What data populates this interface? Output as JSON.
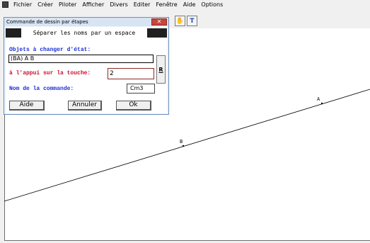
{
  "menubar": {
    "items": [
      "Fichier",
      "Créer",
      "Piloter",
      "Afficher",
      "Divers",
      "Editer",
      "Fenêtre",
      "Aide",
      "Options"
    ]
  },
  "toolbar": {
    "buttons": [
      {
        "icon": "hand-icon",
        "glyph": "✋"
      },
      {
        "icon": "text-tool-icon",
        "glyph": "T"
      }
    ]
  },
  "dialog": {
    "window_title": "Commande de dessin par étapes",
    "close_glyph": "✕",
    "instruction": "Séparer les noms par un espace",
    "objects_label": "Objets à changer d'état:",
    "objects_value": "(BA) A B",
    "key_label": "à l'appui sur la touche:",
    "key_value": "2",
    "command_label": "Nom de la commande:",
    "command_value": "Cm3",
    "r_button": "R",
    "buttons": {
      "help": "Aide",
      "cancel": "Annuler",
      "ok": "Ok"
    }
  },
  "drawing": {
    "points": [
      {
        "name": "A"
      },
      {
        "name": "B"
      }
    ],
    "line_color": "#000000"
  }
}
